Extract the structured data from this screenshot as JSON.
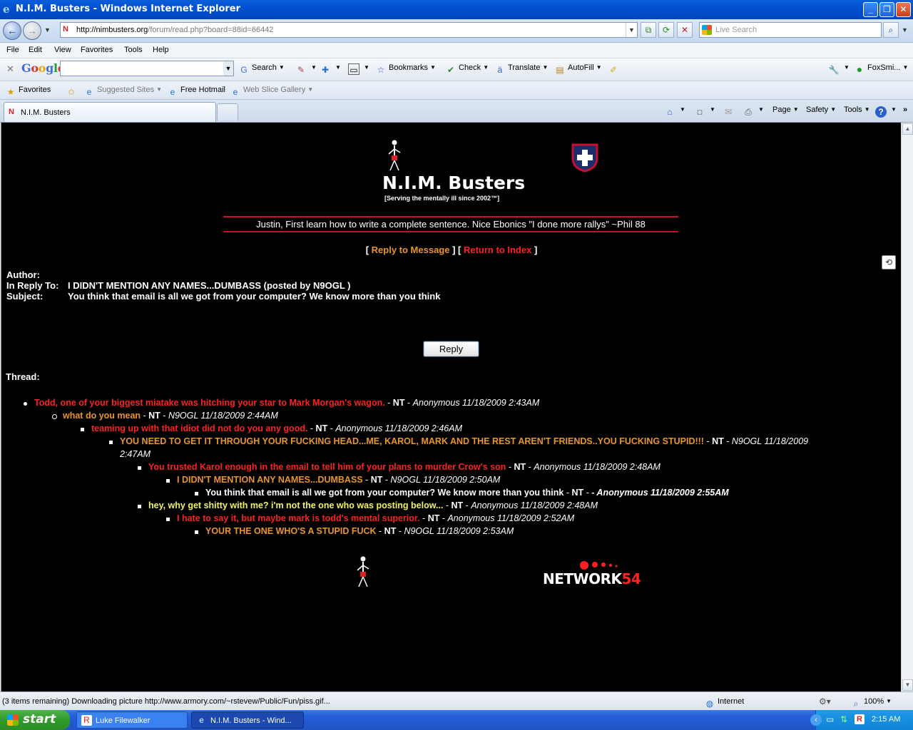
{
  "window": {
    "title": "N.I.M. Busters - Windows Internet Explorer",
    "url_host": "http://nimbusters.org",
    "url_path": "/forum/read.php?board=88id=66442",
    "search_placeholder": "Live Search"
  },
  "menu": [
    "File",
    "Edit",
    "View",
    "Favorites",
    "Tools",
    "Help"
  ],
  "google_toolbar": {
    "logo": "Google",
    "items": [
      "Search",
      "Bookmarks",
      "Check",
      "Translate",
      "AutoFill",
      "FoxSmi..."
    ]
  },
  "favorites_bar": {
    "favorites": "Favorites",
    "items": [
      "Suggested Sites",
      "Free Hotmail",
      "Web Slice Gallery"
    ]
  },
  "tabs": [
    {
      "label": "N.I.M. Busters"
    }
  ],
  "command_bar": [
    "Page",
    "Safety",
    "Tools"
  ],
  "page": {
    "site_title": "N.I.M. Busters",
    "site_subtitle": "[Serving the mentally ill since 2002™]",
    "quote": "Justin, First learn how to write a complete sentence. Nice Ebonics \"I done more rallys\" ~Phil 88",
    "link_reply": "Reply to Message",
    "link_index": "Return to Index",
    "author_label": "Author:",
    "in_reply_label": "In Reply To:",
    "in_reply_value": "I DIDN'T MENTION ANY NAMES...DUMBASS (posted by N9OGL )",
    "subject_label": "Subject:",
    "subject_value": "You think that email is all we got from your computer? We know more than you think",
    "reply_button": "Reply",
    "thread_label": "Thread:",
    "network_logo_a": "NETWORK",
    "network_logo_b": "54",
    "thread": [
      {
        "title": "Todd, one of your biggest miatake was hitching your star to Mark Morgan's wagon.",
        "nt": "NT",
        "author": "Anonymous 11/18/2009 2:43AM",
        "color": "#ff2020"
      },
      {
        "title": "what do you mean",
        "nt": "NT",
        "author": "N9OGL 11/18/2009 2:44AM",
        "color": "#e8952a"
      },
      {
        "title": "teaming up with that idiot did not do you any good.",
        "nt": "NT",
        "author": "Anonymous 11/18/2009 2:46AM",
        "color": "#ff2020"
      },
      {
        "title": "YOU NEED TO GET IT THROUGH YOUR FUCKING HEAD...ME, KAROL, MARK AND THE REST AREN'T FRIENDS..YOU FUCKING STUPID!!!",
        "nt": "NT",
        "author": "N9OGL 11/18/2009",
        "author2": "2:47AM",
        "color": "#e8952a"
      },
      {
        "title": "You trusted Karol enough in the email to tell him of your plans to murder Crow's son",
        "nt": "NT",
        "author": "Anonymous 11/18/2009 2:48AM",
        "color": "#ff2020"
      },
      {
        "title": "I DIDN'T MENTION ANY NAMES...DUMBASS",
        "nt": "NT",
        "author": "N9OGL 11/18/2009 2:50AM",
        "color": "#e8952a"
      },
      {
        "title": "You think that email is all we got from your computer? We know more than you think",
        "nt": "NT",
        "author": "- Anonymous 11/18/2009 2:55AM",
        "color": "#ffffff"
      },
      {
        "title": "hey, why get shitty with me? i'm not the one who was posting below...",
        "nt": "NT",
        "author": "Anonymous 11/18/2009 2:48AM",
        "color": "#f2f260"
      },
      {
        "title": "I hate to say it, but maybe mark is todd's mental superior.",
        "nt": "NT",
        "author": "Anonymous 11/18/2009 2:52AM",
        "color": "#ff2020"
      },
      {
        "title": "YOUR THE ONE WHO'S A STUPID FUCK",
        "nt": "NT",
        "author": "N9OGL 11/18/2009 2:53AM",
        "color": "#e8952a"
      }
    ]
  },
  "status": {
    "message": "(3 items remaining) Downloading picture http://www.armory.com/~rstevew/Public/Fun/piss.gif...",
    "zone": "Internet",
    "zoom": "100%"
  },
  "taskbar": {
    "start": "start",
    "items": [
      "Luke Filewalker",
      "N.I.M. Busters - Wind..."
    ],
    "clock": "2:15 AM"
  }
}
